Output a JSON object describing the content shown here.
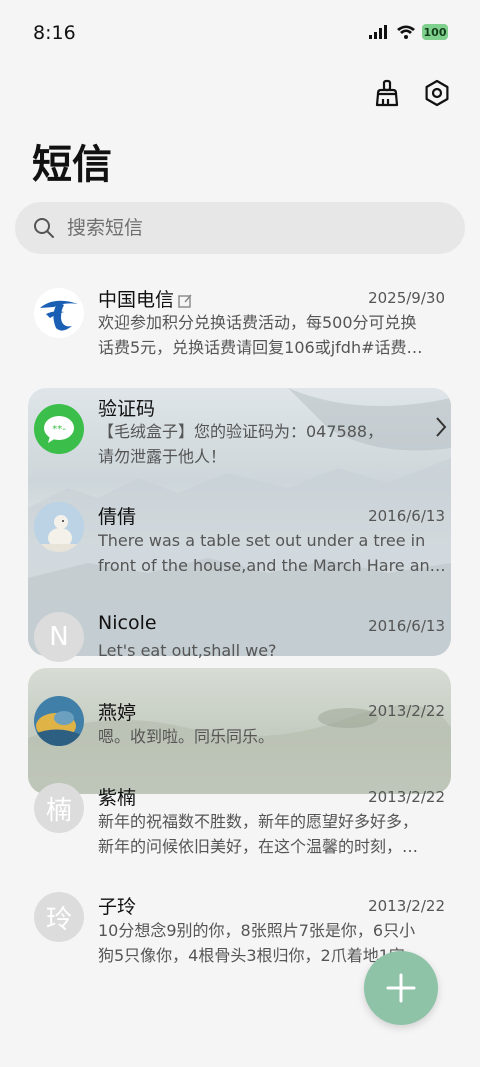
{
  "status": {
    "time": "8:16",
    "battery": "100"
  },
  "header": {
    "title": "短信"
  },
  "search": {
    "placeholder": "搜索短信"
  },
  "messages": [
    {
      "name": "中国电信",
      "date": "2025/9/30",
      "line1": "欢迎参加积分兑换话费活动，每500分可兑换",
      "line2": "话费5元，兑换话费请回复106或jfdh#话费…"
    },
    {
      "name": "验证码",
      "date": "",
      "line1": "【毛绒盒子】您的验证码为：047588，",
      "line2": "请勿泄露于他人！"
    },
    {
      "name": "倩倩",
      "date": "2016/6/13",
      "line1": "There was a table set out under a tree in",
      "line2": "front of the house,and the March Hare an…"
    },
    {
      "name": "Nicole",
      "date": "2016/6/13",
      "avatar_letter": "N",
      "line1": "Let's eat out,shall we?",
      "line2": ""
    },
    {
      "name": "燕婷",
      "date": "2013/2/22",
      "line1": "嗯。收到啦。同乐同乐。",
      "line2": ""
    },
    {
      "name": "紫楠",
      "date": "2013/2/22",
      "avatar_letter": "楠",
      "line1": "新年的祝福数不胜数，新年的愿望好多好多，",
      "line2": "新年的问候依旧美好，在这个温馨的时刻，…"
    },
    {
      "name": "子玲",
      "date": "2013/2/22",
      "avatar_letter": "玲",
      "line1": "10分想念9别的你，8张照片7张是你，6只小",
      "line2": "狗5只像你，4根骨头3根归你，2爪着地1定…"
    }
  ],
  "icons": {
    "clean": "broom-icon",
    "settings": "gear-icon",
    "search": "search-icon",
    "compose": "plus-icon"
  },
  "colors": {
    "fab": "#8ec3a8",
    "telecom_blue": "#1a5fb4",
    "otp_green": "#3bbf4a"
  }
}
